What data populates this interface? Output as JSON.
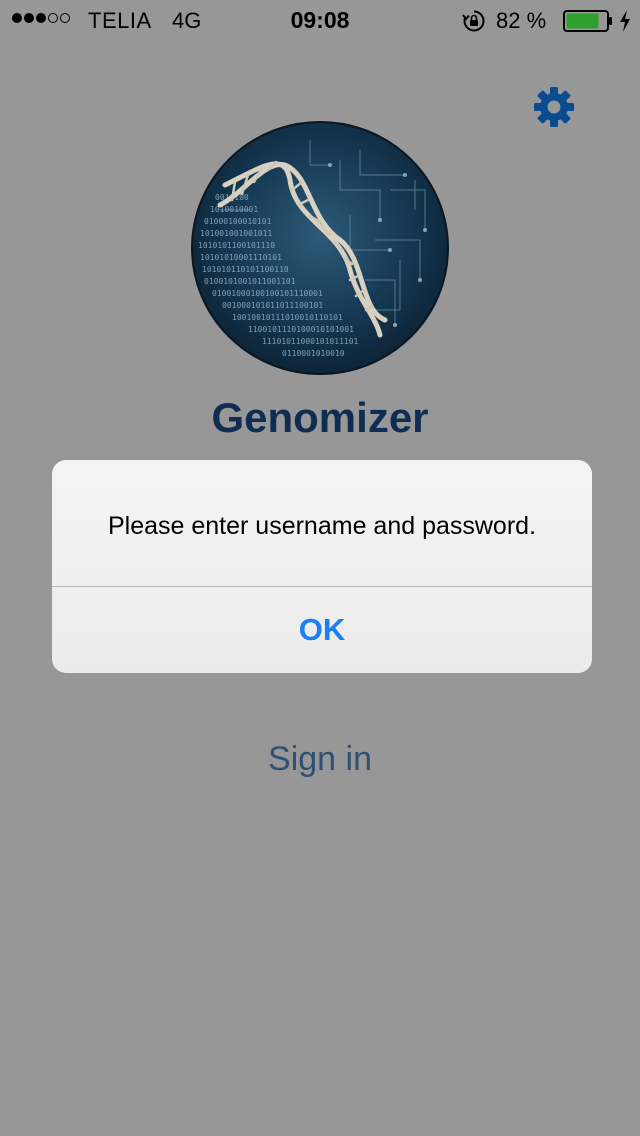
{
  "status_bar": {
    "signal_strength": {
      "filled": 3,
      "total": 5
    },
    "carrier": "TELIA",
    "network": "4G",
    "time": "09:08",
    "battery_percent": "82 %",
    "battery_level": 0.82,
    "icons": [
      "rotation-lock-icon",
      "battery-icon",
      "charging-bolt-icon"
    ]
  },
  "header": {
    "settings_icon": "gear-icon"
  },
  "app": {
    "logo": "dna-binary-logo",
    "title": "Genomizer"
  },
  "login": {
    "sign_in_label": "Sign in"
  },
  "alert": {
    "message": "Please enter username and password.",
    "ok_label": "OK"
  },
  "colors": {
    "dimmed_background": "#979797",
    "title": "#0f2d52",
    "gear": "#0a4a8f",
    "alert_button": "#1a7ef7",
    "battery_fill": "#2ea02e"
  }
}
